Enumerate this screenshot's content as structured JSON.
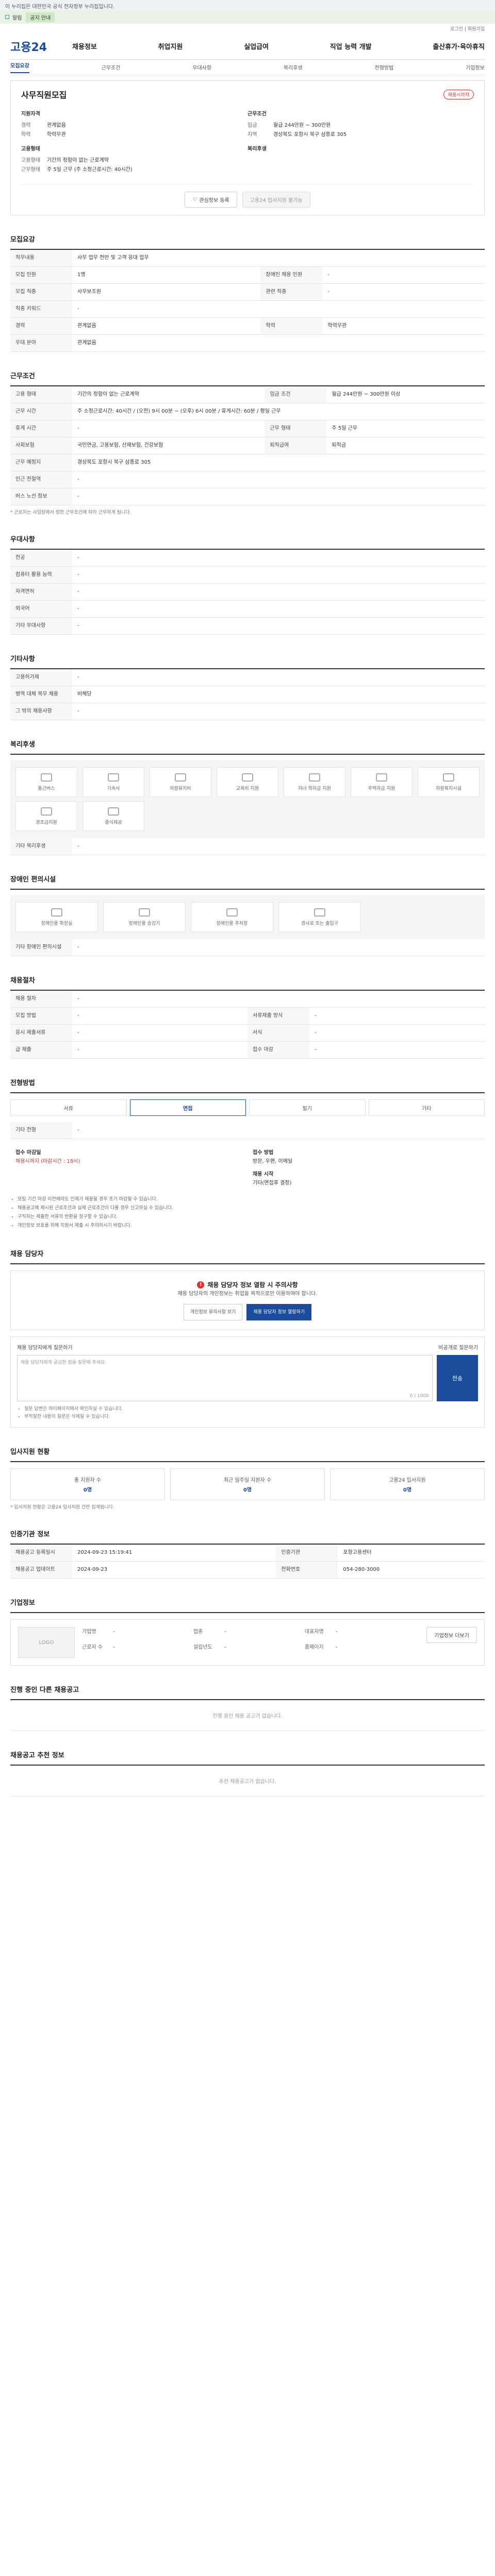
{
  "gov_bar": {
    "text": "이 누리집은 대한민국 공식 전자정부 누리집입니다."
  },
  "alert": {
    "label": "알림",
    "highlight": "공지 안내"
  },
  "util": {
    "links": "로그인 | 회원가입"
  },
  "gnb": {
    "logo": "고용24",
    "menu": [
      "채용정보",
      "취업지원",
      "실업급여",
      "직업 능력 개발",
      "출산휴가·육아휴직"
    ]
  },
  "subtabs": [
    "모집요강",
    "근무조건",
    "우대사항",
    "복리후생",
    "전형방법",
    "기업정보"
  ],
  "hero": {
    "title": "사무직원모집",
    "badge": "채용시까지",
    "col1": {
      "h1": "지원자격",
      "rows1": [
        {
          "k": "경력",
          "v": "관계없음"
        },
        {
          "k": "학력",
          "v": "학력무관"
        }
      ],
      "h2": "고용형태",
      "rows2": [
        {
          "k": "고용형태",
          "v": "기간의 정함이 없는 근로계약"
        },
        {
          "k": "근무형태",
          "v": "주 5일 근무 (주 소정근로시간: 40시간)"
        }
      ]
    },
    "col2": {
      "h1": "근무조건",
      "rows1": [
        {
          "k": "임금",
          "v": "월급 244만원 ~ 300만원"
        },
        {
          "k": "지역",
          "v": "경상북도 포항시 북구 삼흥로 305"
        }
      ],
      "h2": "복리후생",
      "rows2": []
    },
    "btn_fav": "관심정보 등록",
    "btn_apply": "고용24 입사지원 불가능"
  },
  "recruit": {
    "title": "모집요강",
    "job_title_label": "직무내용",
    "job_title_value": "사무 업무 전반 및 고객 응대 업무",
    "rows": [
      {
        "k": "모집 인원",
        "v": "1명",
        "k2": "장애인 채용 인원",
        "v2": "-"
      },
      {
        "k": "모집 직종",
        "v": "사무보조원",
        "k2": "관련 직종",
        "v2": "-"
      },
      {
        "k": "직종 키워드",
        "v": "-",
        "k2": "",
        "v2": ""
      },
      {
        "k": "경력",
        "v": "관계없음",
        "k2": "학력",
        "v2": "학력무관"
      },
      {
        "k": "우대 분야",
        "v": "관계없음",
        "k2": "",
        "v2": ""
      }
    ]
  },
  "work": {
    "title": "근무조건",
    "rows": [
      {
        "k": "고용 형태",
        "v": "기간의 정함이 없는 근로계약",
        "k2": "임금 조건",
        "v2": "월급 244만원 ~ 300만원 이상"
      },
      {
        "k": "근무 시간",
        "v": "주 소정근로시간: 40시간 / (오전) 9시 00분 ~ (오후) 6시 00분 / 휴게시간: 60분 / 평일 근무",
        "k2": "",
        "v2": ""
      },
      {
        "k": "휴게 시간",
        "v": "-",
        "k2": "근무 형태",
        "v2": "주 5일 근무"
      },
      {
        "k": "사회보험",
        "v": "국민연금, 고용보험, 산재보험, 건강보험",
        "k2": "퇴직급여",
        "v2": "퇴직금"
      },
      {
        "k": "근무 예정지",
        "v": "경상북도 포항시 북구 삼흥로 305",
        "k2": "",
        "v2": ""
      },
      {
        "k": "인근 전철역",
        "v": "-",
        "k2": "",
        "v2": ""
      },
      {
        "k": "버스 노선 정보",
        "v": "-",
        "k2": "",
        "v2": ""
      }
    ],
    "note": "* 근로자는 사업장에서 정한 근무조건에 따라 근무하게 됩니다."
  },
  "prefer": {
    "title": "우대사항",
    "rows": [
      {
        "k": "전공",
        "v": "-"
      },
      {
        "k": "컴퓨터 활용 능력",
        "v": "-"
      },
      {
        "k": "자격면허",
        "v": "-"
      },
      {
        "k": "외국어",
        "v": "-"
      },
      {
        "k": "기타 우대사항",
        "v": "-"
      }
    ]
  },
  "etc": {
    "title": "기타사항",
    "rows": [
      {
        "k": "고용허가제",
        "v": "-"
      },
      {
        "k": "병역 대체 복무 채용",
        "v": "비해당"
      }
    ],
    "other_label": "그 밖의 채용사항",
    "other_value": "-"
  },
  "welfare": {
    "title": "복리후생",
    "items": [
      "통근버스",
      "기숙사",
      "차량유지비",
      "교육비 지원",
      "자녀 학자금 지원",
      "주택자금 지원",
      "자원복지시설",
      "경조금지원",
      "중식제공"
    ],
    "other_label": "기타 복리후생",
    "other_value": "-"
  },
  "disabled": {
    "title": "장애인 편의시설",
    "items": [
      "장애인용 화장실",
      "장애인용 승강기",
      "장애인용 주차장",
      "경사로 또는 출입구"
    ],
    "other_label": "기타 장애인 편의시설",
    "other_value": "-"
  },
  "process": {
    "title": "채용절차",
    "rows": [
      {
        "k": "채용 절차",
        "v": "-",
        "k2": "",
        "v2": ""
      },
      {
        "k": "모집 방법",
        "v": "-",
        "k2": "서류제출 방식",
        "v2": "-"
      },
      {
        "k": "응시 제출서류",
        "v": "-",
        "k2": "서식",
        "v2": "-"
      },
      {
        "k": "급 제출",
        "v": "-",
        "k2": "접수 마감",
        "v2": "-"
      }
    ]
  },
  "method": {
    "title": "전형방법",
    "tabs": [
      "서류",
      "면접",
      "필기",
      "기타"
    ],
    "other_label": "기타 전형",
    "other_value": "-",
    "col1_h": "접수 마감일",
    "col1_v": "채용시까지 (마감시간 : 18시)",
    "col2_h": "접수 방법",
    "col2_v": "방문, 우편, 이메일",
    "col3_h": "채용 시작",
    "col3_v": "기타(면접후 결정)",
    "warnings": [
      "모집 기간 마감 이전에라도 인재가 채용될 경우 조기 마감될 수 있습니다.",
      "채용공고에 제시된 근로조건과 실제 근로조건이 다를 경우 신고하실 수 있습니다.",
      "구직자는 제출한 서류의 반환을 청구할 수 있습니다.",
      "개인정보 보호를 위해 지원서 제출 시 주의하시기 바랍니다."
    ]
  },
  "contact": {
    "title": "채용 담당자",
    "warn": "채용 담당자 정보 열람 시 주의사항",
    "desc": "채용 담당자의 개인정보는 취업을 목적으로만 이용하여야 합니다.",
    "btn1": "개인정보 유의사항 보기",
    "btn2": "채용 담당자 정보 열람하기",
    "inq_label": "채용 담당자에게 질문하기",
    "inq_right": "비공개로 질문하기",
    "placeholder": "채용 담당자에게 궁금한 점을 질문해 주세요.",
    "counter": "0 / 1000",
    "send": "전송",
    "notes": [
      "질문 답변은 마이페이지에서 확인하실 수 있습니다.",
      "부적절한 내용의 질문은 삭제될 수 있습니다."
    ]
  },
  "stats": {
    "title": "입사지원 현황",
    "items": [
      {
        "label": "총 지원자 수",
        "value": "0명"
      },
      {
        "label": "최근 일주일 지원자 수",
        "value": "0명"
      },
      {
        "label": "고용24 입사지원",
        "value": "0명"
      }
    ],
    "note": "* 입사지원 현황은 고용24 입사지원 건만 집계됩니다."
  },
  "org": {
    "title": "인증기관 정보",
    "rows": [
      {
        "k": "채용공고 등록일시",
        "v": "2024-09-23 15:19:41",
        "k2": "인증기관",
        "v2": "포항고용센터"
      },
      {
        "k": "채용공고 업데이트",
        "v": "2024-09-23",
        "k2": "전화번호",
        "v2": "054-280-3000"
      }
    ]
  },
  "company": {
    "title": "기업정보",
    "logo": "LOGO",
    "info": [
      {
        "k": "기업명",
        "v": "-"
      },
      {
        "k": "업종",
        "v": "-"
      },
      {
        "k": "대표자명",
        "v": "-"
      },
      {
        "k": "근로자 수",
        "v": "-"
      },
      {
        "k": "설립년도",
        "v": "-"
      },
      {
        "k": "홈페이지",
        "v": "-"
      }
    ],
    "btn": "기업정보 더보기"
  },
  "same_jobs": {
    "title": "진행 중인 다른 채용공고",
    "empty": "진행 중인 채용 공고가 없습니다."
  },
  "recommend": {
    "title": "채용공고 추천 정보",
    "empty": "추천 채용공고가 없습니다."
  }
}
